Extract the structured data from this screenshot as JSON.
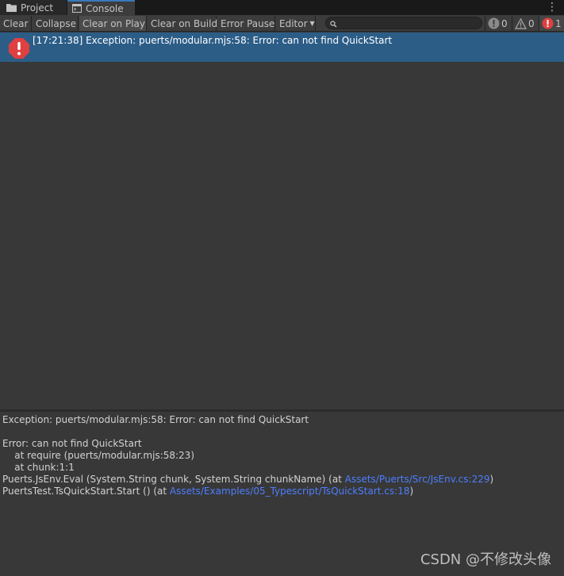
{
  "tabs": [
    {
      "label": "Project",
      "icon": "folder-icon"
    },
    {
      "label": "Console",
      "icon": "console-icon"
    }
  ],
  "toolbar": {
    "clear": "Clear",
    "collapse": "Collapse",
    "clear_on_play": "Clear on Play",
    "clear_on_build": "Clear on Build",
    "error_pause": "Error Pause",
    "editor": "Editor",
    "search_placeholder": "",
    "info_count": "0",
    "warning_count": "0",
    "error_count": "1"
  },
  "log": {
    "entries": [
      {
        "text": "[17:21:38] Exception: puerts/modular.mjs:58: Error: can not find QuickStart",
        "level": "error"
      }
    ]
  },
  "detail": {
    "line1": "Exception: puerts/modular.mjs:58: Error: can not find QuickStart",
    "line2": "Error: can not find QuickStart",
    "line3": "    at require (puerts/modular.mjs:58:23)",
    "line4": "    at chunk:1:1",
    "line5_prefix": "Puerts.JsEnv.Eval (System.String chunk, System.String chunkName) (at ",
    "line5_link": "Assets/Puerts/Src/JsEnv.cs:229",
    "line5_suffix": ")",
    "line6_prefix": "PuertsTest.TsQuickStart.Start () (at ",
    "line6_link": "Assets/Examples/05_Typescript/TsQuickStart.cs:18",
    "line6_suffix": ")"
  },
  "watermark": "CSDN @不修改头像",
  "colors": {
    "selected_row": "#2c5d87",
    "error_red": "#e04040",
    "link": "#4c7eff",
    "accent_tab": "#3a79bb"
  }
}
